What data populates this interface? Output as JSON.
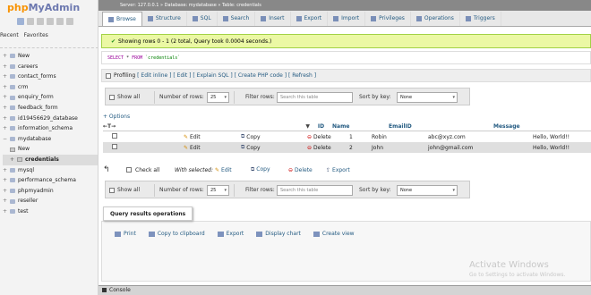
{
  "sidebar": {
    "logo_php": "php",
    "logo_myadmin": "MyAdmin",
    "nav_recent": "Recent",
    "nav_favorites": "Favorites",
    "items": [
      {
        "label": "New"
      },
      {
        "label": "careers"
      },
      {
        "label": "contact_forms"
      },
      {
        "label": "crm"
      },
      {
        "label": "enquiry_form"
      },
      {
        "label": "feedback_form"
      },
      {
        "label": "id19456629_database"
      },
      {
        "label": "information_schema"
      },
      {
        "label": "mydatabase"
      }
    ],
    "sub_items": [
      {
        "label": "New"
      },
      {
        "label": "credentials"
      }
    ],
    "items_after": [
      {
        "label": "mysql"
      },
      {
        "label": "performance_schema"
      },
      {
        "label": "phpmyadmin"
      },
      {
        "label": "reseller"
      },
      {
        "label": "test"
      }
    ]
  },
  "breadcrumb": "Server: 127.0.0.1 » Database: mydatabase » Table: credentials",
  "tabs": [
    {
      "label": "Browse"
    },
    {
      "label": "Structure"
    },
    {
      "label": "SQL"
    },
    {
      "label": "Search"
    },
    {
      "label": "Insert"
    },
    {
      "label": "Export"
    },
    {
      "label": "Import"
    },
    {
      "label": "Privileges"
    },
    {
      "label": "Operations"
    },
    {
      "label": "Triggers"
    }
  ],
  "success_message": "Showing rows 0 - 1 (2 total, Query took 0.0004 seconds.)",
  "sql": {
    "kw1": "SELECT",
    "star": " * ",
    "kw2": "FROM",
    "table": " `credentials`"
  },
  "profiling": {
    "label": "Profiling",
    "links": "[ Edit inline ] [ Edit ] [ Explain SQL ] [ Create PHP code ] [ Refresh ]"
  },
  "nav": {
    "show_all": "Show all",
    "num_rows_label": "Number of rows:",
    "num_rows_value": "25",
    "filter_label": "Filter rows:",
    "filter_placeholder": "Search this table",
    "sort_label": "Sort by key:",
    "sort_value": "None"
  },
  "options_link": "+ Options",
  "columns": [
    "ID",
    "Name",
    "EmailID",
    "Message"
  ],
  "sort_arrow": "▼",
  "col_nav": "←T→",
  "rows": [
    {
      "id": "1",
      "name": "Robin",
      "email": "abc@xyz.com",
      "message": "Hello, World!!"
    },
    {
      "id": "2",
      "name": "John",
      "email": "john@gmail.com",
      "message": "Hello, World!!"
    }
  ],
  "row_actions": {
    "edit": "Edit",
    "copy": "Copy",
    "delete": "Delete"
  },
  "bulk": {
    "check_all": "Check all",
    "with_selected": "With selected:",
    "edit": "Edit",
    "copy": "Copy",
    "delete": "Delete",
    "export": "Export"
  },
  "qro": {
    "title": "Query results operations",
    "print": "Print",
    "copy_clipboard": "Copy to clipboard",
    "export": "Export",
    "display_chart": "Display chart",
    "create_view": "Create view"
  },
  "watermark": {
    "title": "Activate Windows",
    "sub": "Go to Settings to activate Windows."
  },
  "console": "Console"
}
